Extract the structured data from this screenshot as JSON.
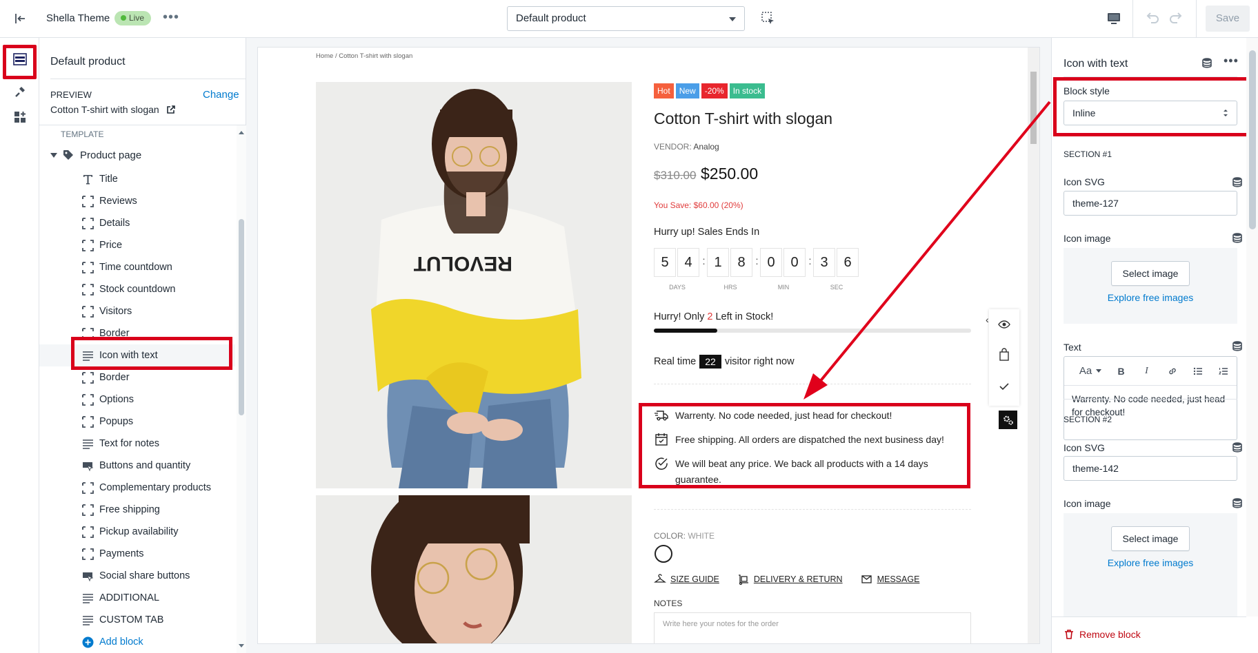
{
  "topbar": {
    "theme_name": "Shella Theme",
    "live_badge": "Live",
    "more": "•••",
    "page_select": "Default product",
    "save": "Save"
  },
  "sidebar": {
    "title": "Default product",
    "preview_label": "PREVIEW",
    "change_link": "Change",
    "preview_value": "Cotton T-shirt with slogan",
    "template_label": "TEMPLATE",
    "page_label": "Product page",
    "items": [
      {
        "label": "Title",
        "icon": "title-icon"
      },
      {
        "label": "Reviews",
        "icon": "block-icon"
      },
      {
        "label": "Details",
        "icon": "block-icon"
      },
      {
        "label": "Price",
        "icon": "block-icon"
      },
      {
        "label": "Time countdown",
        "icon": "block-icon"
      },
      {
        "label": "Stock countdown",
        "icon": "block-icon"
      },
      {
        "label": "Visitors",
        "icon": "block-icon"
      },
      {
        "label": "Border",
        "icon": "block-icon"
      },
      {
        "label": "Icon with text",
        "icon": "text-lines-icon"
      },
      {
        "label": "Border",
        "icon": "block-icon"
      },
      {
        "label": "Options",
        "icon": "block-icon"
      },
      {
        "label": "Popups",
        "icon": "block-icon"
      },
      {
        "label": "Text for notes",
        "icon": "text-lines-icon"
      },
      {
        "label": "Buttons and quantity",
        "icon": "cursor-block-icon"
      },
      {
        "label": "Complementary products",
        "icon": "block-icon"
      },
      {
        "label": "Free shipping",
        "icon": "block-icon"
      },
      {
        "label": "Pickup availability",
        "icon": "block-icon"
      },
      {
        "label": "Payments",
        "icon": "block-icon"
      },
      {
        "label": "Social share buttons",
        "icon": "cursor-block-icon"
      },
      {
        "label": "ADDITIONAL",
        "icon": "text-lines-icon"
      },
      {
        "label": "CUSTOM TAB",
        "icon": "text-lines-icon"
      }
    ],
    "add_block": "Add block",
    "selected_index": 8
  },
  "preview": {
    "breadcrumb": "Home  /  Cotton T-shirt with slogan",
    "badges": [
      {
        "label": "Hot",
        "color": "#f5603d"
      },
      {
        "label": "New",
        "color": "#4b9ee8"
      },
      {
        "label": "-20%",
        "color": "#e8262d"
      },
      {
        "label": "In stock",
        "color": "#3bbc8f"
      }
    ],
    "title": "Cotton T-shirt with slogan",
    "vendor_key": "VENDOR:",
    "vendor": "Analog",
    "price_old": "$310.00",
    "price_new": "$250.00",
    "you_save": "You Save: $60.00 (20%)",
    "hurry": "Hurry up! Sales Ends In",
    "countdown": [
      {
        "digits": [
          "5",
          "4"
        ],
        "unit": "DAYS"
      },
      {
        "digits": [
          "1",
          "8"
        ],
        "unit": "HRS"
      },
      {
        "digits": [
          "0",
          "0"
        ],
        "unit": "MIN"
      },
      {
        "digits": [
          "3",
          "6"
        ],
        "unit": "SEC"
      }
    ],
    "stock_prefix": "Hurry! Only ",
    "stock_count": "2",
    "stock_suffix": " Left in Stock!",
    "stock_fill_fraction": 0.2,
    "realtime_prefix": "Real time",
    "realtime_count": "22",
    "realtime_suffix": "visitor right now",
    "icon_rows": [
      {
        "icon": "shipping-fast-icon",
        "text": "Warrenty. No code needed, just head for checkout!"
      },
      {
        "icon": "calendar-icon",
        "text": "Free shipping. All orders are dispatched the next business day!"
      },
      {
        "icon": "check-circle-icon",
        "text": "We will beat any price. We back all products with a 14 days guarantee."
      }
    ],
    "color_label": "COLOR:",
    "color_value": "WHITE",
    "links": [
      {
        "label": "SIZE GUIDE",
        "icon": "hanger-icon"
      },
      {
        "label": "DELIVERY & RETURN",
        "icon": "truck-icon"
      },
      {
        "label": "MESSAGE",
        "icon": "envelope-icon"
      }
    ],
    "notes_label": "NOTES",
    "notes_placeholder": "Write here your notes for the order"
  },
  "right_panel": {
    "title": "Icon with text",
    "block_style_label": "Block style",
    "block_style_value": "Inline",
    "section1": {
      "heading": "SECTION #1",
      "icon_svg_label": "Icon SVG",
      "icon_svg_value": "theme-127",
      "icon_image_label": "Icon image",
      "select_image": "Select image",
      "explore": "Explore free images",
      "text_label": "Text",
      "text_value": "Warrenty. No code needed, just head for checkout!"
    },
    "section2": {
      "heading": "SECTION #2",
      "icon_svg_label": "Icon SVG",
      "icon_svg_value": "theme-142",
      "icon_image_label": "Icon image",
      "select_image": "Select image",
      "explore": "Explore free images"
    },
    "remove_block": "Remove block"
  },
  "colors": {
    "highlight_red": "#d9001b",
    "link_blue": "#007ace"
  }
}
